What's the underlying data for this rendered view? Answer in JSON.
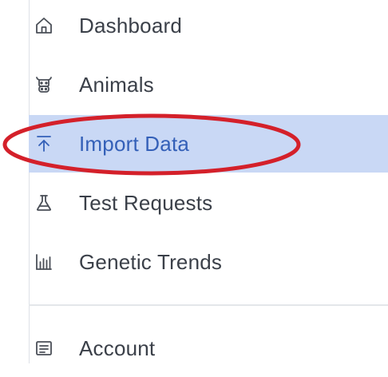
{
  "sidebar": {
    "items": [
      {
        "label": "Dashboard",
        "icon": "home-icon",
        "active": false
      },
      {
        "label": "Animals",
        "icon": "cow-icon",
        "active": false
      },
      {
        "label": "Import Data",
        "icon": "upload-icon",
        "active": true
      },
      {
        "label": "Test Requests",
        "icon": "flask-icon",
        "active": false
      },
      {
        "label": "Genetic Trends",
        "icon": "bar-chart-icon",
        "active": false
      }
    ],
    "footer_items": [
      {
        "label": "Account",
        "icon": "id-card-icon",
        "active": false
      }
    ]
  },
  "annotation": {
    "color": "#d4202a",
    "shape": "ellipse"
  },
  "colors": {
    "active_background": "#c9d8f5",
    "active_text": "#3460b8",
    "text": "#3b4049",
    "icon": "#4a4f57"
  }
}
